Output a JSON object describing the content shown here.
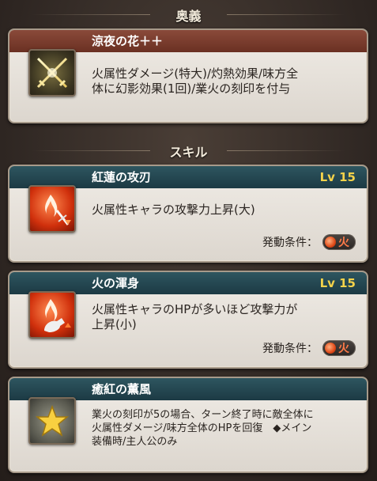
{
  "sections": {
    "ougi_title": "奥義",
    "skill_title": "スキル"
  },
  "ougi": {
    "name": "涼夜の花＋＋",
    "desc_line1": "火属性ダメージ(特大)/灼熱効果/味方全",
    "desc_line2": "体に幻影効果(1回)/業火の刻印を付与",
    "icon": "crossed-swords-icon"
  },
  "skills": [
    {
      "name": "紅蓮の攻刃",
      "level": "Lv 15",
      "desc_line1": "火属性キャラの攻撃力上昇(大)",
      "desc_line2": "",
      "condition_label": "発動条件：",
      "element": "火",
      "icon": "fire-sword-icon"
    },
    {
      "name": "火の渾身",
      "level": "Lv 15",
      "desc_line1": "火属性キャラのHPが多いほど攻撃力が",
      "desc_line2": "上昇(小)",
      "condition_label": "発動条件：",
      "element": "火",
      "icon": "fire-arm-icon"
    },
    {
      "name": "癒紅の薫風",
      "desc_line1": "業火の刻印が5の場合、ターン終了時に敵全体に",
      "desc_line2": "火属性ダメージ/味方全体のHPを回復　◆メイン",
      "desc_line3": "装備時/主人公のみ",
      "icon": "star-icon"
    }
  ],
  "colors": {
    "fire": "#e04a18",
    "level_gold": "#f4d24a",
    "ougi_bar": "#7a3e2e",
    "skill_bar": "#244650"
  }
}
